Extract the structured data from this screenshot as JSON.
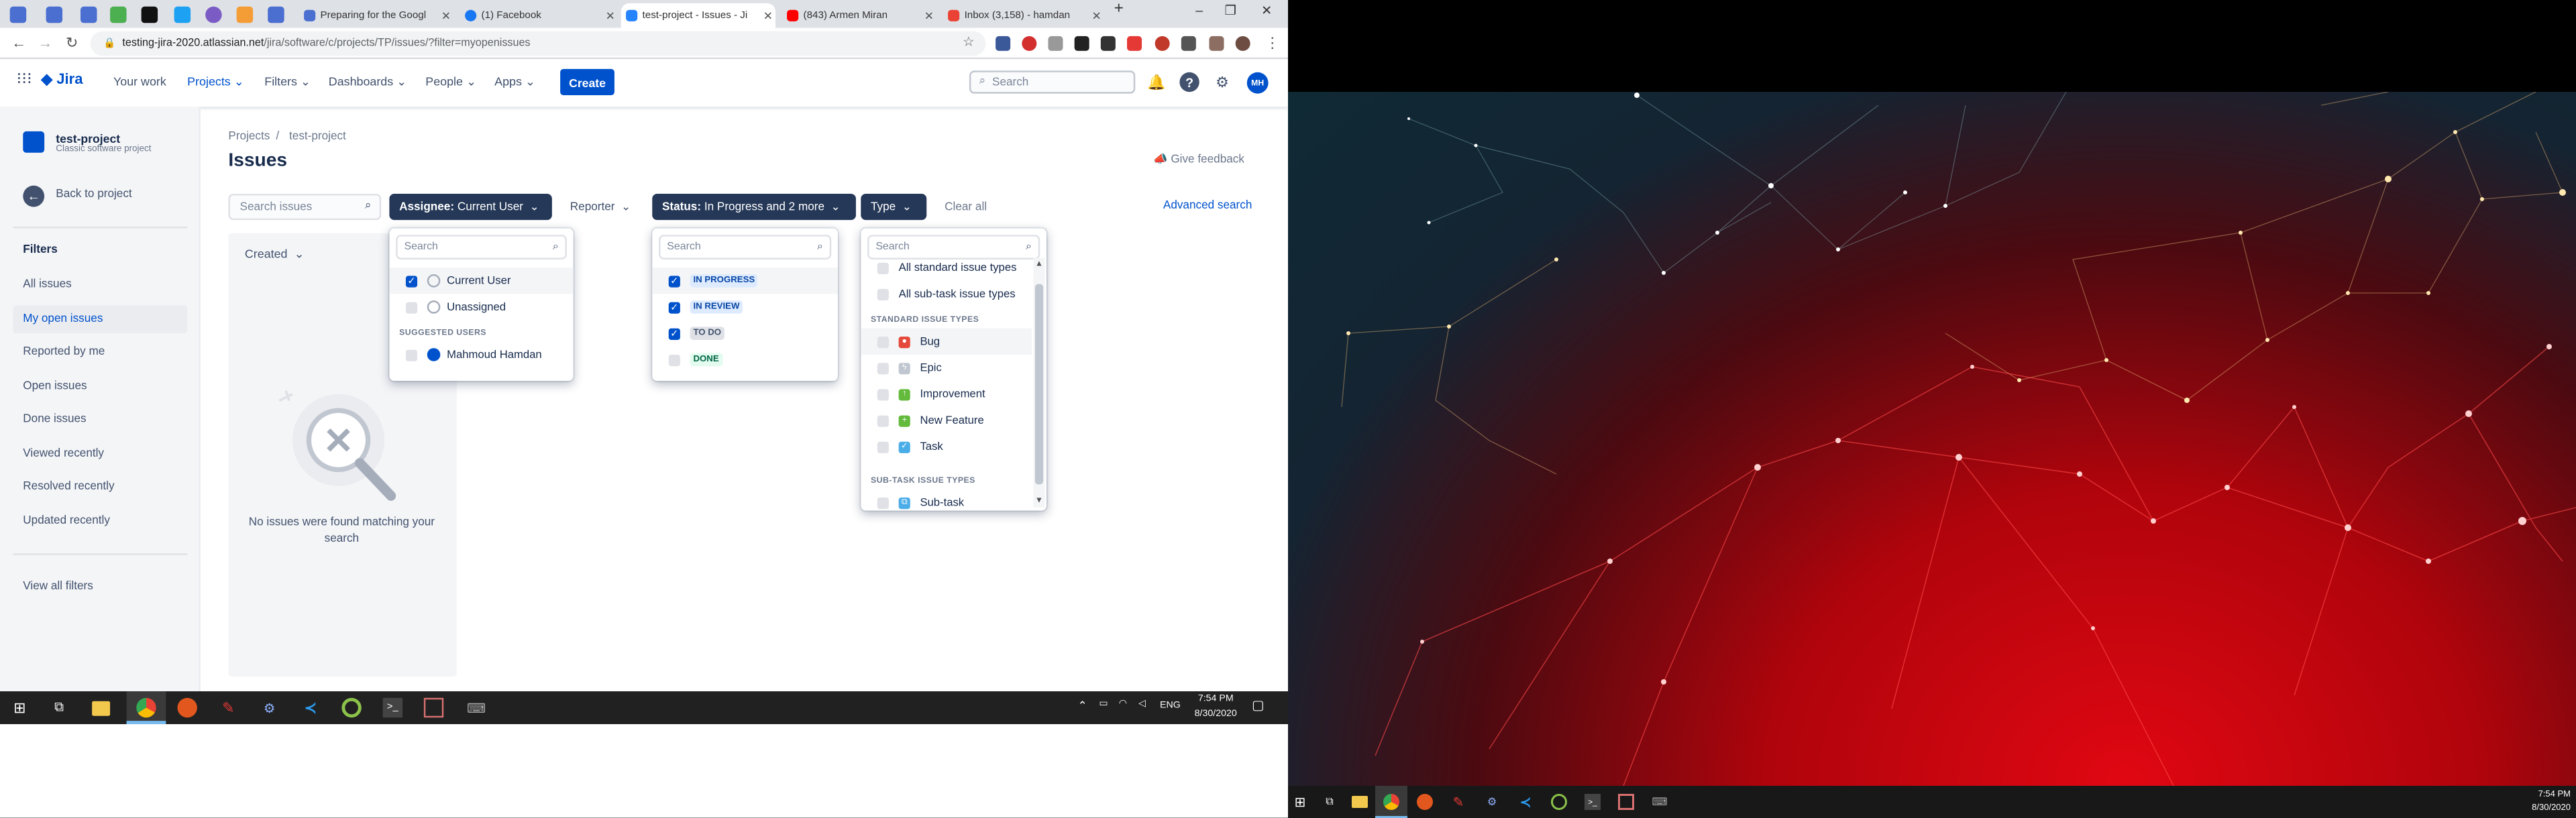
{
  "browser": {
    "tabs": [
      {
        "label": "Preparing for the Googl",
        "favicon": "link-icon"
      },
      {
        "label": "(1) Facebook",
        "favicon": "facebook-icon"
      },
      {
        "label": "test-project - Issues - Ji",
        "favicon": "jira-icon"
      },
      {
        "label": "(843) Armen Miran",
        "favicon": "youtube-icon"
      },
      {
        "label": "Inbox (3,158) - hamdan",
        "favicon": "gmail-icon"
      }
    ],
    "url_host": "testing-jira-2020.atlassian.net",
    "url_path": "/jira/software/c/projects/TP/issues/?filter=myopenissues",
    "new_tab": "+",
    "window_controls": {
      "minimize": "–",
      "maximize": "❐",
      "close": "✕"
    }
  },
  "jira_nav": {
    "logo": "Jira",
    "your_work": "Your work",
    "projects": "Projects",
    "filters": "Filters",
    "dashboards": "Dashboards",
    "people": "People",
    "apps": "Apps",
    "create": "Create",
    "search_placeholder": "Search",
    "avatar": "MH"
  },
  "sidebar": {
    "project_name": "test-project",
    "project_type": "Classic software project",
    "back": "Back to project",
    "filters_heading": "Filters",
    "items": [
      "All issues",
      "My open issues",
      "Reported by me",
      "Open issues",
      "Done issues",
      "Viewed recently",
      "Resolved recently",
      "Updated recently"
    ],
    "view_all": "View all filters"
  },
  "main": {
    "breadcrumb_root": "Projects",
    "breadcrumb_sep": "/",
    "breadcrumb_project": "test-project",
    "title": "Issues",
    "feedback": "Give feedback",
    "search_placeholder": "Search issues",
    "assignee_prefix": "Assignee:",
    "assignee_value": "Current User",
    "reporter": "Reporter",
    "status_prefix": "Status:",
    "status_value": "In Progress and 2 more",
    "type": "Type",
    "clear_all": "Clear all",
    "advanced_search": "Advanced search",
    "sort": "Created",
    "empty_message": "No issues were found matching your search"
  },
  "assignee_dropdown": {
    "search_placeholder": "Search",
    "options": [
      {
        "label": "Current User",
        "checked": true
      },
      {
        "label": "Unassigned",
        "checked": false
      }
    ],
    "suggested_heading": "SUGGESTED USERS",
    "suggested": [
      {
        "label": "Mahmoud Hamdan",
        "checked": false
      }
    ]
  },
  "status_dropdown": {
    "search_placeholder": "Search",
    "options": [
      {
        "label": "IN PROGRESS",
        "checked": true,
        "color": "#0747a6",
        "bg": "#deebff"
      },
      {
        "label": "IN REVIEW",
        "checked": true,
        "color": "#0747a6",
        "bg": "#deebff"
      },
      {
        "label": "TO DO",
        "checked": true,
        "color": "#42526e",
        "bg": "#dfe1e6"
      },
      {
        "label": "DONE",
        "checked": false,
        "color": "#006644",
        "bg": "#e3fcef"
      }
    ]
  },
  "type_dropdown": {
    "search_placeholder": "Search",
    "top_options": [
      "All standard issue types",
      "All sub-task issue types"
    ],
    "standard_heading": "STANDARD ISSUE TYPES",
    "standard": [
      {
        "label": "Bug",
        "icon": "bug-icon",
        "color": "#e5493a"
      },
      {
        "label": "Epic",
        "icon": "epic-icon",
        "color": "#904ee2"
      },
      {
        "label": "Improvement",
        "icon": "improvement-icon",
        "color": "#63ba3c"
      },
      {
        "label": "New Feature",
        "icon": "new-feature-icon",
        "color": "#63ba3c"
      },
      {
        "label": "Task",
        "icon": "task-icon",
        "color": "#4bade8"
      }
    ],
    "subtask_heading": "SUB-TASK ISSUE TYPES",
    "subtask": [
      {
        "label": "Sub-task",
        "icon": "subtask-icon",
        "color": "#4bade8"
      }
    ]
  },
  "taskbar": {
    "language": "ENG",
    "time": "7:54 PM",
    "date": "8/30/2020"
  },
  "taskbar2": {
    "time": "7:54 PM",
    "date": "8/30/2020"
  },
  "colors": {
    "jira_blue": "#0052cc",
    "filter_dark": "#253858"
  }
}
